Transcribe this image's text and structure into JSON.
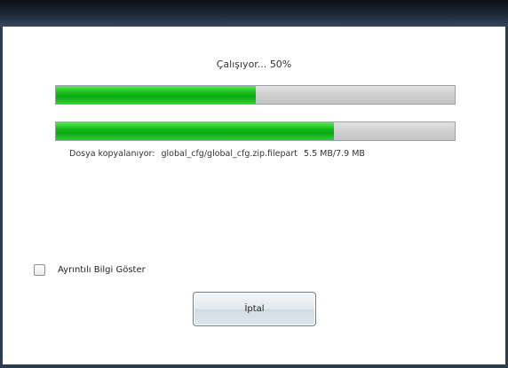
{
  "window": {
    "status_label": "Çalışıyor...",
    "status_percent": "50%"
  },
  "overall_progress": {
    "percent": 50
  },
  "file_progress": {
    "label": "Dosya kopyalanıyor:",
    "file_path": "global_cfg/global_cfg.zip.filepart",
    "size": "5.5 MB/7.9 MB",
    "fraction": 0.696
  },
  "details_checkbox": {
    "label": "Ayrıntılı Bilgi Göster",
    "checked": false
  },
  "cancel_button": {
    "label": "İptal"
  },
  "colors": {
    "progress_fill": "#17c01c",
    "progress_track": "#d1d1d1",
    "titlebar": "#1f2a3a"
  }
}
